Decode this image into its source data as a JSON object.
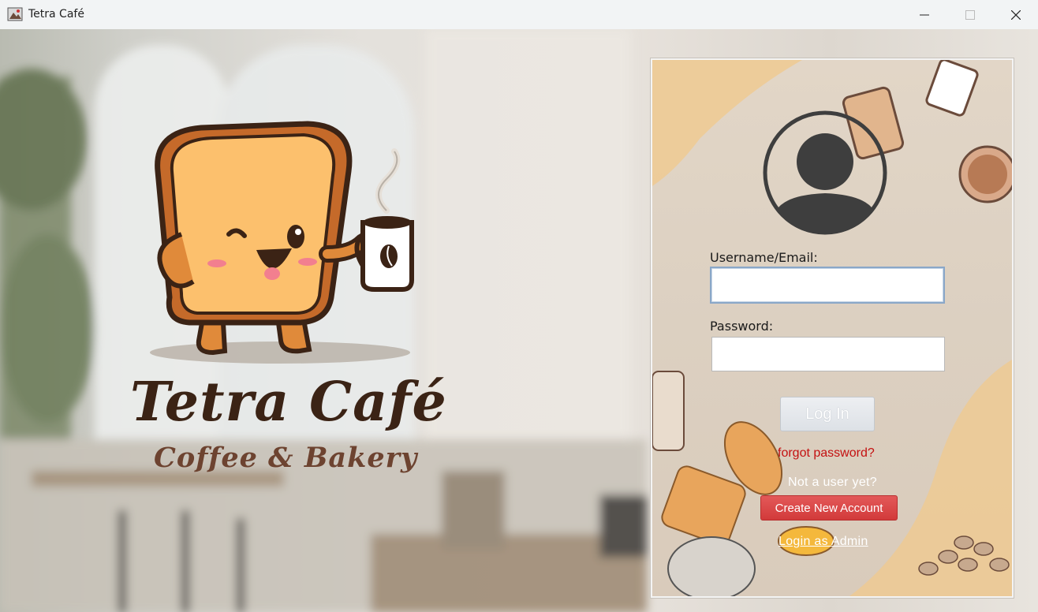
{
  "window": {
    "title": "Tetra Café"
  },
  "brand": {
    "name": "Tetra Café",
    "tagline": "Coffee & Bakery"
  },
  "login": {
    "username_label": "Username/Email:",
    "username_value": "",
    "password_label": "Password:",
    "password_value": "",
    "login_button": "Log In",
    "forgot_link": "forgot password?",
    "not_user_text": "Not a user yet?",
    "create_button": "Create New Account",
    "admin_link": "Login as Admin"
  },
  "colors": {
    "accent_red": "#d23a3a",
    "link_red": "#c41010",
    "brand_brown": "#3b2315"
  },
  "icons": [
    "app-icon",
    "minimize-icon",
    "maximize-icon",
    "close-icon",
    "user-avatar-icon",
    "mascot-toast",
    "coffee-mug"
  ]
}
